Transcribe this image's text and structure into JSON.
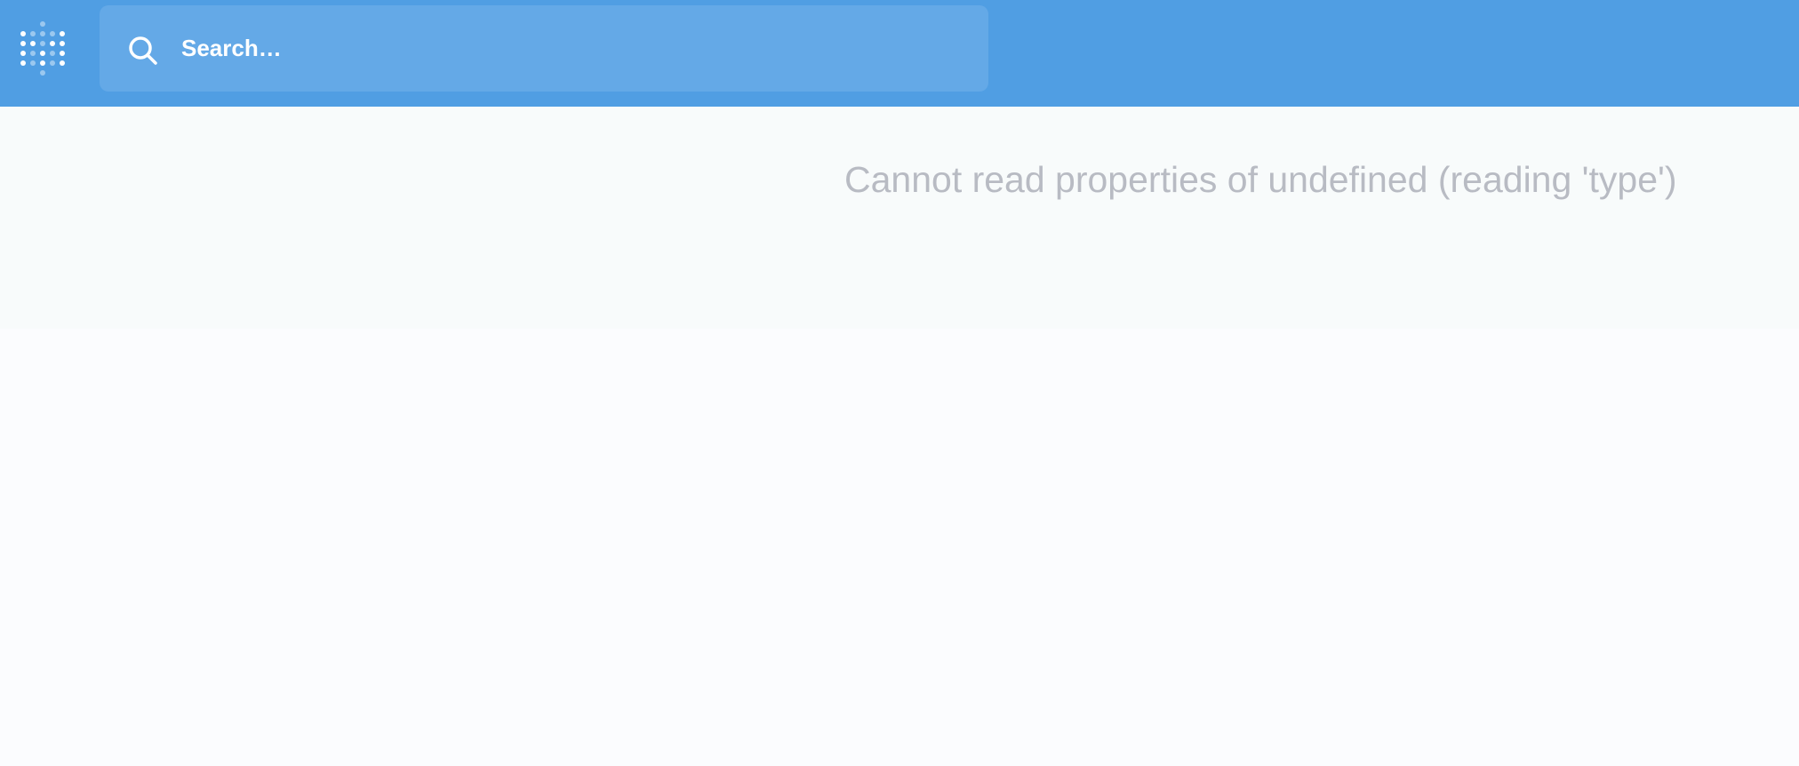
{
  "header": {
    "brand_icon": "metabase-logo-icon",
    "search": {
      "icon": "search-icon",
      "placeholder": "Search…",
      "value": ""
    }
  },
  "main": {
    "error_message": "Cannot read properties of undefined (reading 'type')"
  },
  "colors": {
    "header_bg": "#509ee3",
    "search_bg": "#64a9e7",
    "page_bg": "#fbfcfe",
    "error_text": "#b8bbc3"
  }
}
